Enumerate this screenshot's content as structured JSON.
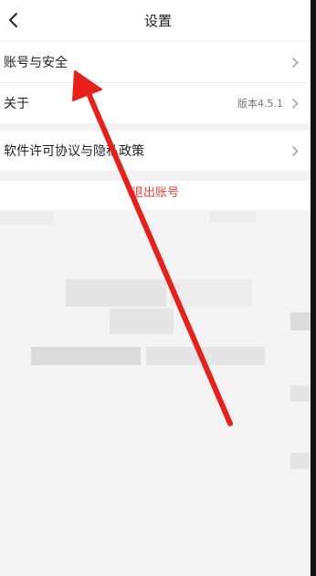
{
  "header": {
    "title": "设置",
    "back_icon": "chevron-left-icon"
  },
  "settings": {
    "account_security": {
      "label": "账号与安全"
    },
    "about": {
      "label": "关于",
      "version": "版本4.5.1"
    },
    "license_privacy": {
      "label": "软件许可协议与隐私政策"
    },
    "logout": {
      "label": "退出账号"
    }
  },
  "colors": {
    "accent_red": "#e0443a",
    "arrow_red": "#e8201c",
    "background": "#f4f4f4"
  },
  "icons": {
    "row_chevron": "chevron-right-icon"
  }
}
